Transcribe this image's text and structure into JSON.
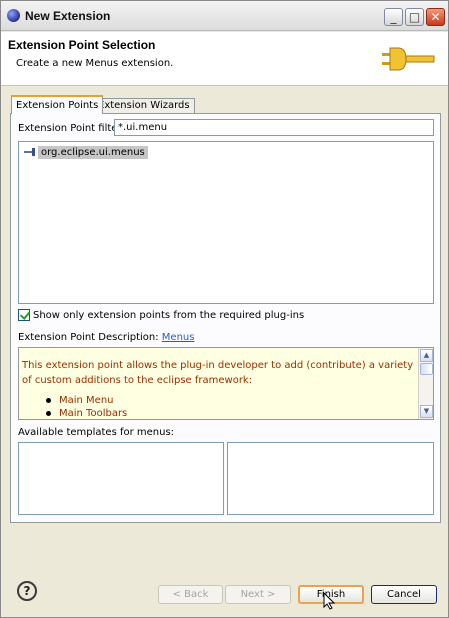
{
  "window": {
    "title": "New Extension",
    "controls": {
      "minimize": "_",
      "maximize": "□",
      "close": "✕"
    }
  },
  "header": {
    "title": "Extension Point Selection",
    "description": "Create a new Menus extension.",
    "icon": "plug-icon"
  },
  "tabs": [
    {
      "label": "Extension Points",
      "active": true
    },
    {
      "label": "Extension Wizards",
      "active": false
    }
  ],
  "filter": {
    "label": "Extension Point filter:",
    "value": "*.ui.menu"
  },
  "tree": {
    "items": [
      {
        "label": "org.eclipse.ui.menus",
        "selected": true,
        "icon": "extension-point-icon"
      }
    ]
  },
  "required_only": {
    "label": "Show only extension points from the required plug-ins",
    "checked": true
  },
  "description": {
    "label": "Extension Point Description:",
    "link": "Menus",
    "text": "This extension point allows the plug-in developer to add (contribute) a variety of custom additions to the eclipse framework:",
    "bullets": [
      "Main Menu",
      "Main Toolbars"
    ]
  },
  "templates": {
    "label": "Available templates for menus:"
  },
  "footer": {
    "help": "?",
    "back": "< Back",
    "next": "Next >",
    "finish": "Finish",
    "cancel": "Cancel"
  },
  "colors": {
    "description_text": "#9a2e00",
    "description_bg": "#ffffe1",
    "link": "#2b59c6",
    "tab_accent": "#e7a03a"
  }
}
